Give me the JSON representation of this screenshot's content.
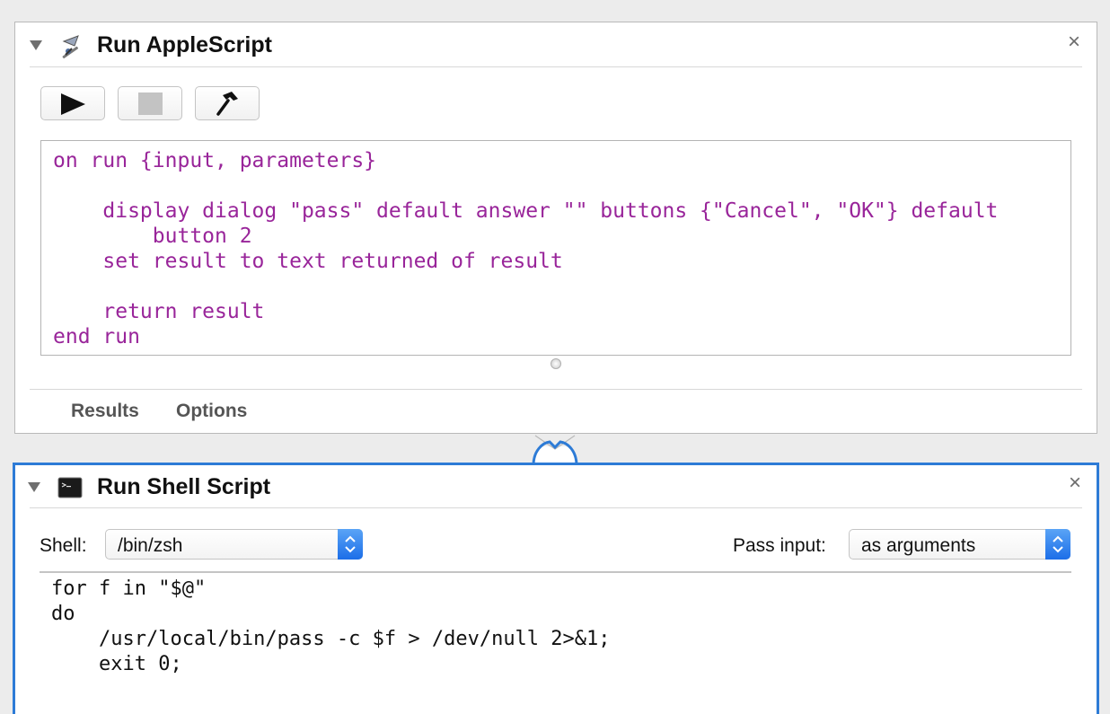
{
  "applescript_action": {
    "title": "Run AppleScript",
    "icon": "applescript-icon",
    "toolbar": {
      "run_icon": "play-icon",
      "stop_icon": "stop-icon",
      "compile_icon": "hammer-icon"
    },
    "code": "on run {input, parameters}\n\n    display dialog \"pass\" default answer \"\" buttons {\"Cancel\", \"OK\"} default\n        button 2\n    set result to text returned of result\n\n    return result\nend run",
    "code_color": "#99259a",
    "footer_tabs": [
      "Results",
      "Options"
    ]
  },
  "shell_action": {
    "title": "Run Shell Script",
    "icon": "terminal-icon",
    "shell_label": "Shell:",
    "shell_value": "/bin/zsh",
    "pass_input_label": "Pass input:",
    "pass_input_value": "as arguments",
    "code": "for f in \"$@\"\ndo\n    /usr/local/bin/pass -c $f > /dev/null 2>&1;\n    exit 0;",
    "selected_border_color": "#2d7bd6"
  },
  "close_glyph": "×"
}
